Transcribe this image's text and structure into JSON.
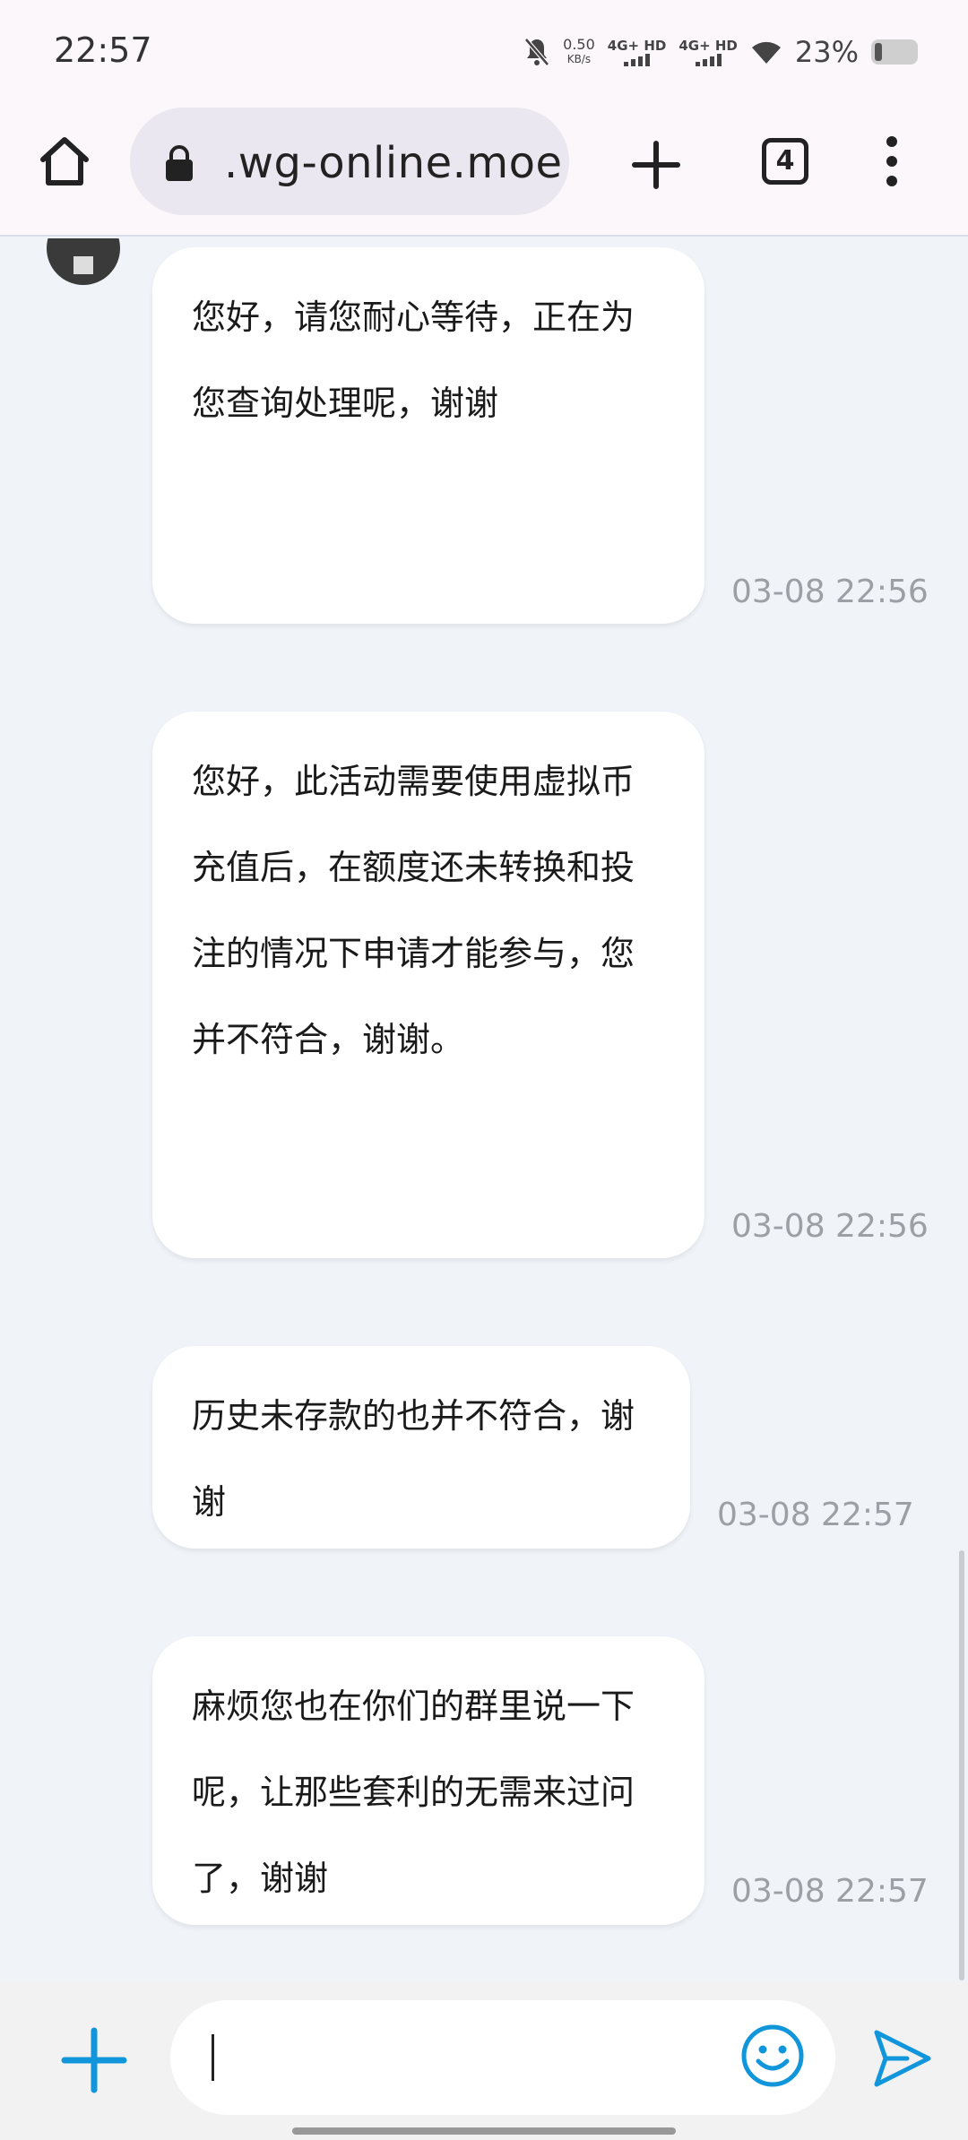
{
  "status_bar": {
    "time": "22:57",
    "net_speed_value": "0.50",
    "net_speed_unit": "KB/s",
    "sim1_label": "4G+ HD",
    "sim2_label": "4G+ HD",
    "battery": "23%",
    "icons": [
      "mute-icon",
      "signal-icon",
      "wifi-icon",
      "battery-icon"
    ]
  },
  "browser": {
    "url": ".wg-online.moe",
    "tab_count": "4",
    "icons": [
      "home-icon",
      "lock-icon",
      "new-tab-icon",
      "tabs-icon",
      "more-menu-icon"
    ]
  },
  "messages": [
    {
      "lines": [
        "您好，请您耐心等待，正在为",
        "您查询处理呢，谢谢"
      ],
      "time": "03-08 22:56"
    },
    {
      "lines": [
        "您好，此活动需要使用虚拟币",
        "充值后，在额度还未转换和投",
        "注的情况下申请才能参与，您",
        "并不符合，谢谢。"
      ],
      "time": "03-08 22:56"
    },
    {
      "lines": [
        "历史未存款的也并不符合，谢",
        "谢"
      ],
      "time": "03-08 22:57"
    },
    {
      "lines": [
        "麻烦您也在你们的群里说一下",
        "呢，让那些套利的无需来过问",
        "了，谢谢"
      ],
      "time": "03-08 22:57"
    }
  ],
  "composer": {
    "value": "",
    "icons": [
      "add-icon",
      "emoji-icon",
      "send-icon"
    ],
    "accent": "#1296db"
  }
}
